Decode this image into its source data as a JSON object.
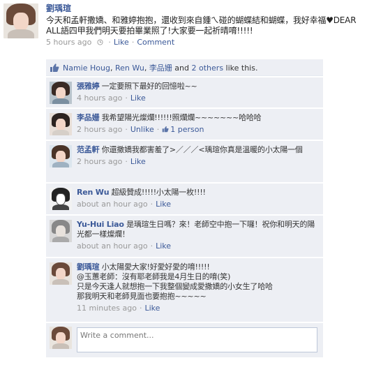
{
  "post": {
    "author": "劉瑀瑄",
    "text": "今天和孟軒撒嬌、和雅婷抱抱，還收到來自鍾ㄟ碰的蝴蝶結和蝴蝶，我好幸福♥DEAR ALL語四甲我們明天要拍畢業照了!大家要一起祈晴唷!!!!!",
    "time": "5 hours ago",
    "like_label": "Like",
    "comment_label": "Comment"
  },
  "likes": {
    "names": [
      "Namie Houg",
      "Ren Wu",
      "李品姗"
    ],
    "sep1": ", ",
    "sep2": ", ",
    "and_text": " and ",
    "others": "2 others",
    "suffix": " like this."
  },
  "comments": [
    {
      "author": "張雅婷",
      "text": "一定要照下最好的回憶啦~~",
      "time": "4 hours ago",
      "action": "Like",
      "likes": ""
    },
    {
      "author": "李品姗",
      "text": "我希望陽光燦爛!!!!!!照爛爛~~~~~~~哈哈哈",
      "time": "2 hours ago",
      "action": "Unlike",
      "likes": "1 person"
    },
    {
      "author": "范孟軒",
      "text": "你還撒嬌我都害羞了>／／／<瑀瑄你真是溫暖的小太陽一個",
      "time": "2 hours ago",
      "action": "Like",
      "likes": ""
    },
    {
      "author": "Ren Wu",
      "text": "超級贊成!!!!!小太陽一枚!!!!",
      "time": "about an hour ago",
      "action": "Like",
      "likes": ""
    },
    {
      "author": "Yu-Hui Liao",
      "text": "是瑀瑄生日嗎？來！老師空中抱一下囉！祝你和明天的陽光都一樣燦爛！",
      "time": "about an hour ago",
      "action": "Like",
      "likes": ""
    },
    {
      "author": "劉瑀瑄",
      "text": "小太陽愛大家!好愛好愛的唷!!!!!",
      "text2": "@玉蕙老師：沒有耶老師我是4月生日的唷(笑)",
      "text3": "只是今天逢人就想抱一下我整個變成愛撒嬌的小女生了哈哈",
      "text4": "那我明天和老師見面也要抱抱~~~~~",
      "time": "11 minutes ago",
      "action": "Like",
      "likes": ""
    }
  ],
  "composer": {
    "placeholder": "Write a comment..."
  },
  "colors": {
    "link": "#3b5998",
    "panel": "#edeff4",
    "meta": "#999999"
  }
}
